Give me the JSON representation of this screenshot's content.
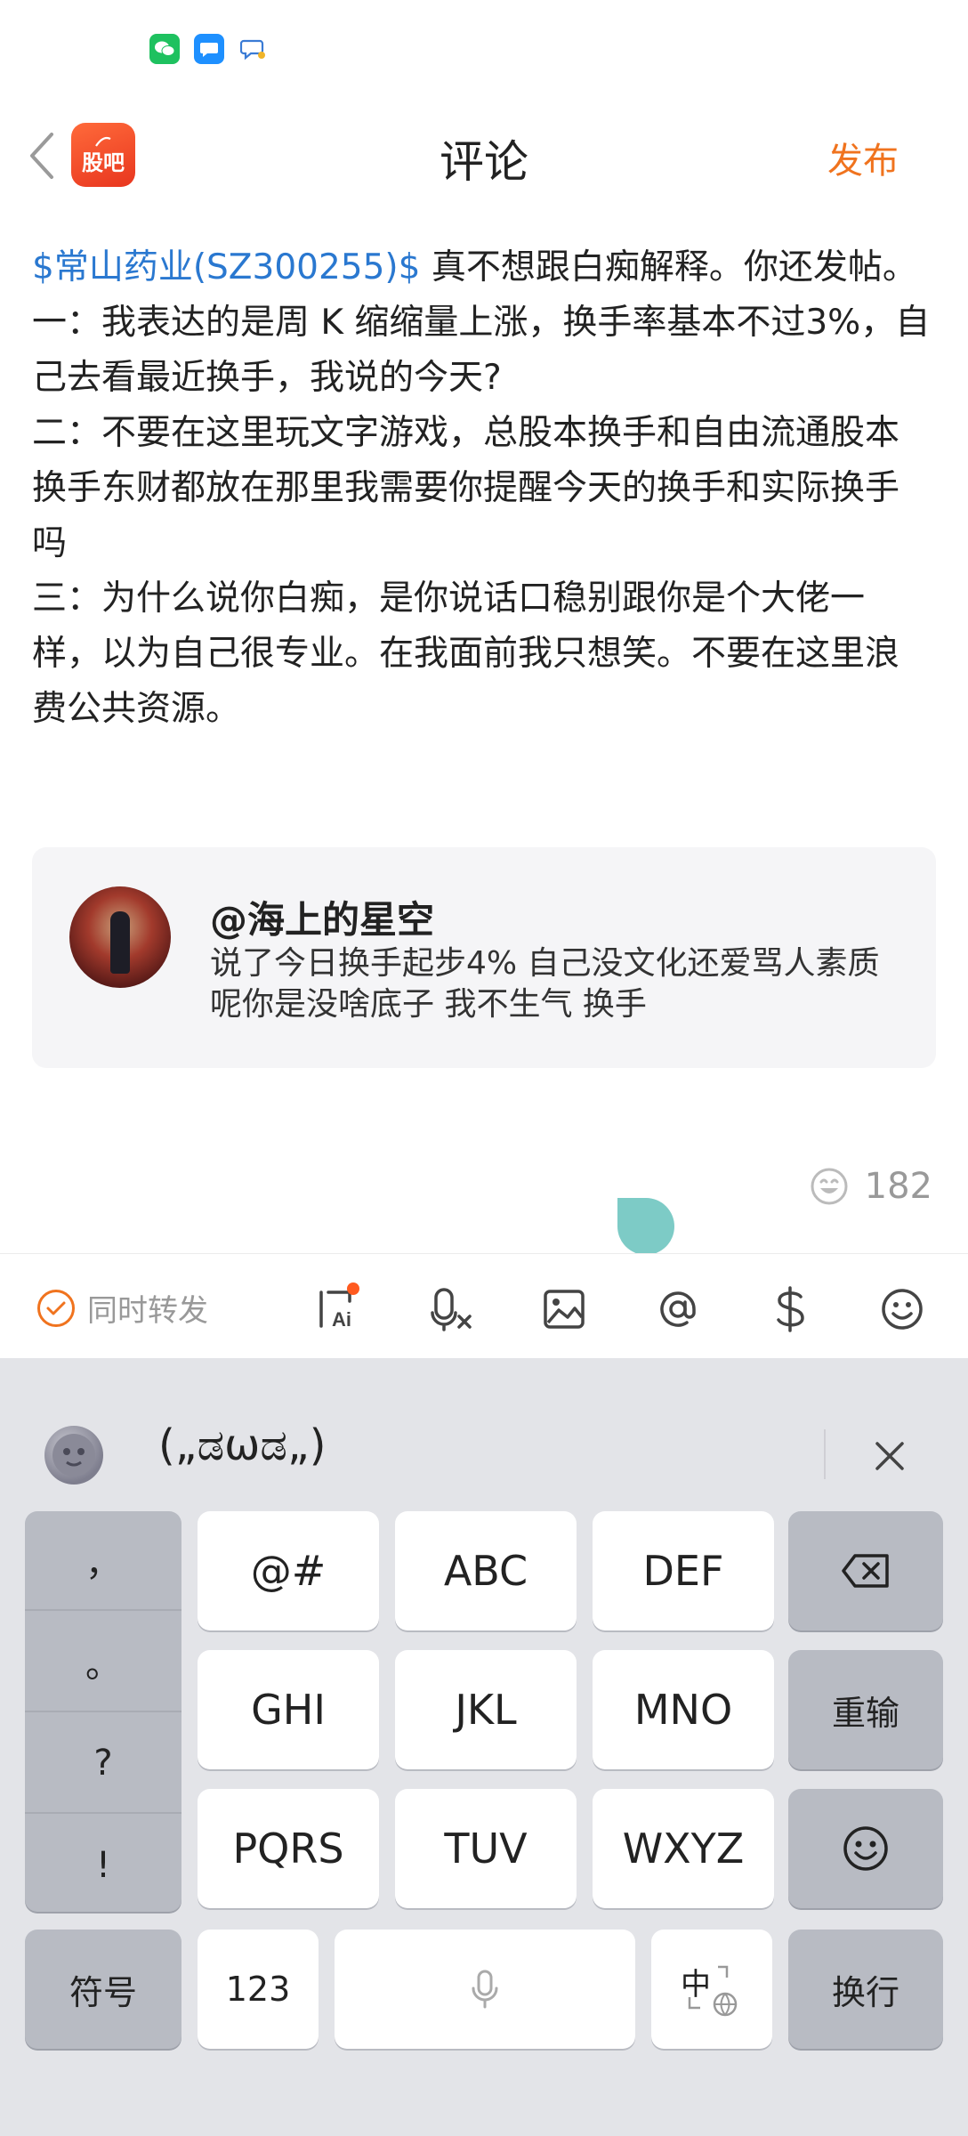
{
  "status_bar": {
    "icons": [
      "wechat-icon",
      "message-icon",
      "chat-icon"
    ]
  },
  "header": {
    "app_logo_text": "股吧",
    "title": "评论",
    "publish_label": "发布"
  },
  "post": {
    "stock_link": "$常山药业(SZ300255)$",
    "lines": [
      " 真不想跟白痴解释。你还发帖。",
      "一：我表达的是周 K 缩缩量上涨，换手率基本不过3%，自己去看最近换手，我说的今天?",
      "二：不要在这里玩文字游戏，总股本换手和自由流通股本换手东财都放在那里我需要你提醒今天的换手和实际换手吗",
      "三：为什么说你白痴，是你说话口稳别跟你是个大佬一样，以为自己很专业。在我面前我只想笑。不要在这里浪费公共资源。"
    ]
  },
  "quote": {
    "name": "@海上的星空",
    "text": "说了今日换手起步4%  自己没文化还爱骂人素质呢你是没啥底子  我不生气 换手"
  },
  "likes": {
    "count": "182"
  },
  "toolbar": {
    "repost_label": "同时转发",
    "icons": [
      "ai-ask-icon",
      "voice-search-icon",
      "image-icon",
      "mention-icon",
      "dollar-icon",
      "emoji-icon"
    ]
  },
  "keyboard": {
    "candidate": "(„ಡωಡ„)",
    "punctuation": [
      "，",
      "。",
      "?",
      "!"
    ],
    "row1": [
      "@#",
      "ABC",
      "DEF"
    ],
    "row2": [
      "GHI",
      "JKL",
      "MNO"
    ],
    "row2_right": "重输",
    "row3": [
      "PQRS",
      "TUV",
      "WXYZ"
    ],
    "bottom": {
      "symbols": "符号",
      "numbers": "123",
      "enter": "换行",
      "lang": "中"
    }
  }
}
